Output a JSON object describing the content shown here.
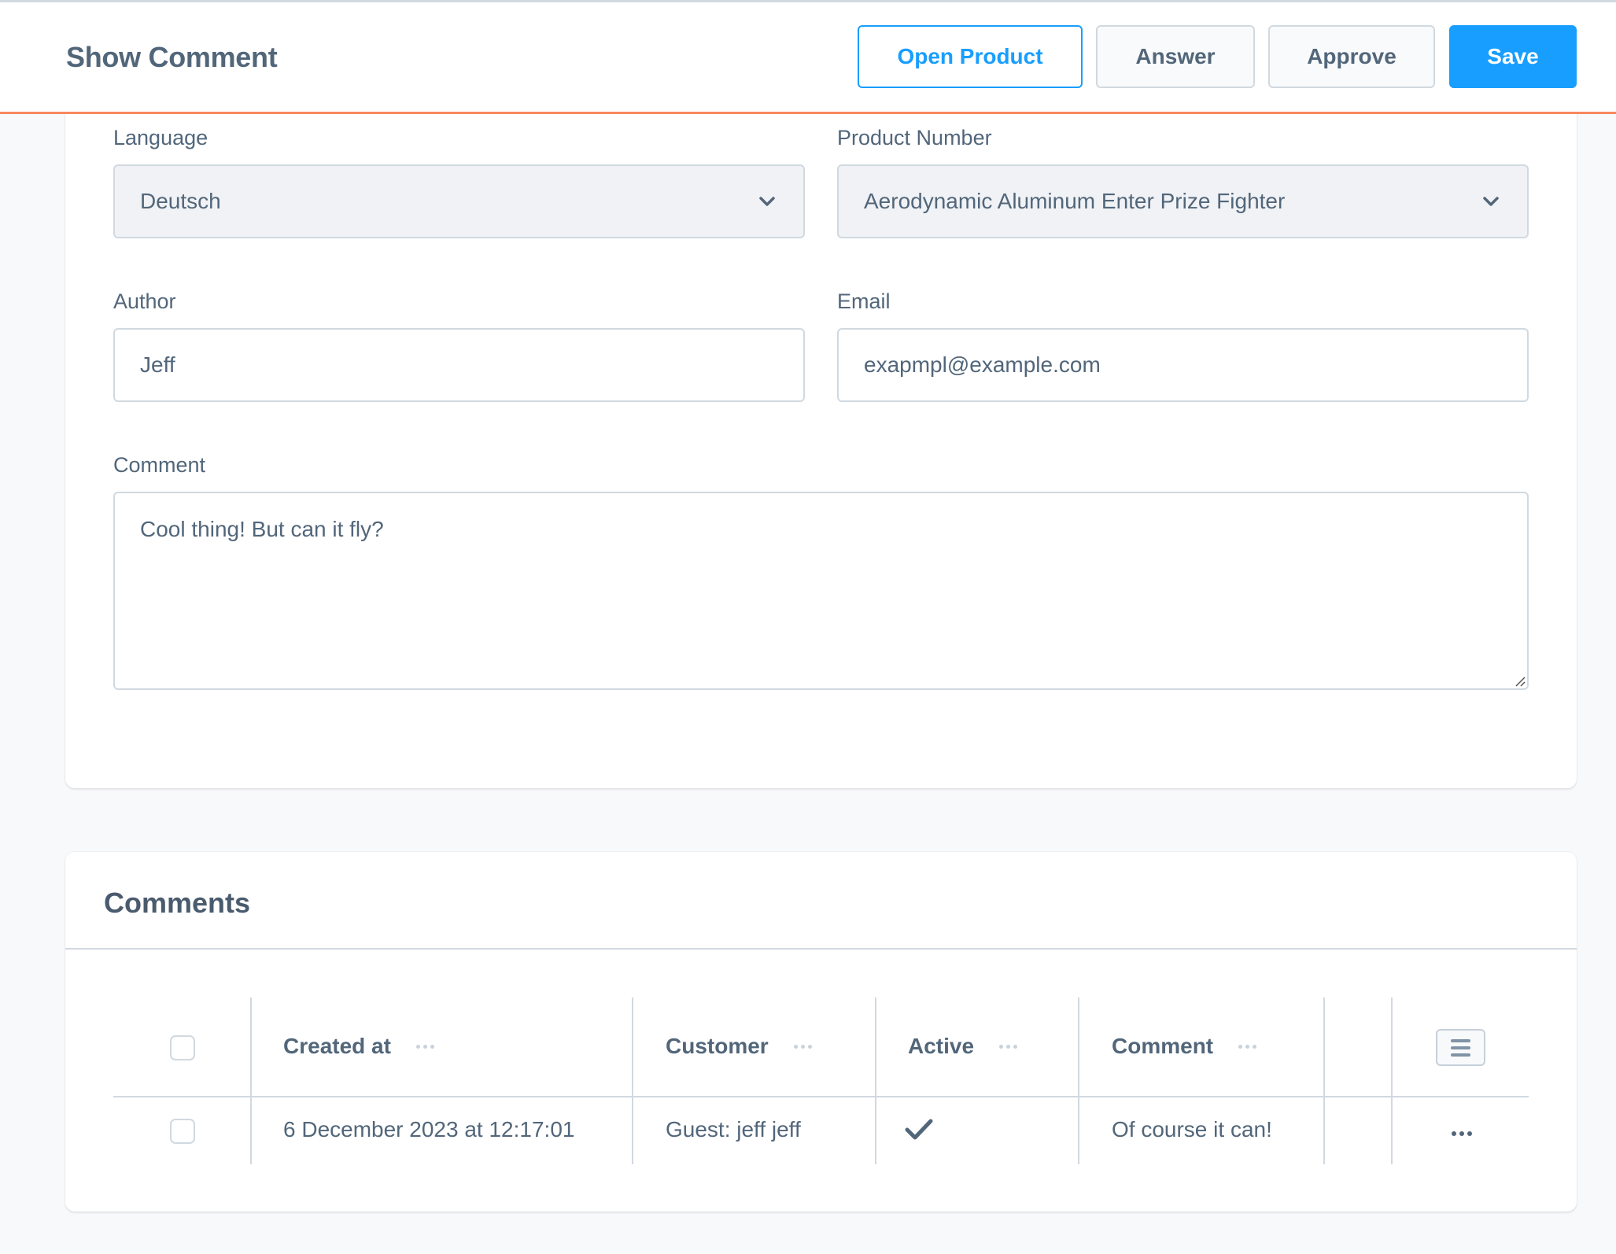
{
  "header": {
    "title": "Show Comment",
    "buttons": {
      "open_product": "Open Product",
      "answer": "Answer",
      "approve": "Approve",
      "save": "Save"
    },
    "accent_color": "#189eff",
    "underline_color": "#f7875e"
  },
  "form": {
    "language": {
      "label": "Language",
      "value": "Deutsch"
    },
    "product_number": {
      "label": "Product Number",
      "value": "Aerodynamic Aluminum Enter Prize Fighter"
    },
    "author": {
      "label": "Author",
      "value": "Jeff"
    },
    "email": {
      "label": "Email",
      "value": "exapmpl@example.com"
    },
    "comment": {
      "label": "Comment",
      "value": "Cool thing! But can it fly?"
    }
  },
  "comments_card": {
    "title": "Comments",
    "columns": [
      "Created at",
      "Customer",
      "Active",
      "Comment"
    ],
    "rows": [
      {
        "created_at": "6 December 2023 at 12:17:01",
        "customer": "Guest: jeff jeff",
        "active": true,
        "comment": "Of course it can!"
      }
    ]
  }
}
